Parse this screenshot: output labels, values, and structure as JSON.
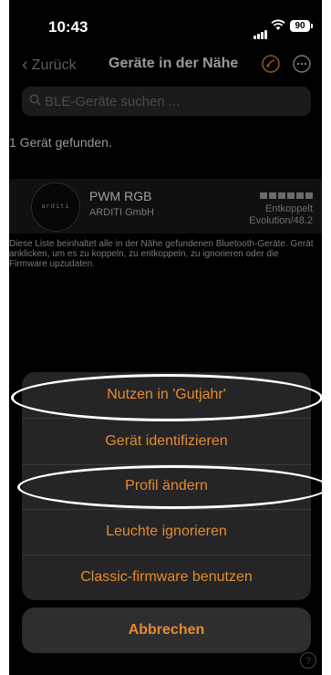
{
  "status_bar": {
    "time": "10:43",
    "battery": "90"
  },
  "nav": {
    "back_label": "Zurück",
    "title": "Geräte in der Nähe",
    "icons": [
      "signal-icon",
      "more-icon"
    ]
  },
  "search": {
    "placeholder": "BLE-Geräte suchen ..."
  },
  "result_count": "1 Gerät gefunden.",
  "device": {
    "name": "PWM RGB",
    "maker": "ARDITI GmbH",
    "logo_text": "arditi",
    "status": "Entkoppelt",
    "firmware": "Evolution/48.2"
  },
  "info_text": "Diese Liste beinhaltet alle in der Nähe gefundenen Bluetooth-Geräte. Gerät anklicken, um es zu koppeln, zu entkoppeln, zu ignorieren oder die Firmware upzudaten.",
  "action_sheet": {
    "items": [
      {
        "label": "Nutzen in 'Gutjahr'"
      },
      {
        "label": "Gerät identifizieren"
      },
      {
        "label": "Profil ändern"
      },
      {
        "label": "Leuchte ignorieren"
      },
      {
        "label": "Classic-firmware benutzen"
      }
    ],
    "cancel_label": "Abbrechen"
  },
  "colors": {
    "accent": "#e38b2d",
    "background": "#000000",
    "sheet": "#252527"
  }
}
